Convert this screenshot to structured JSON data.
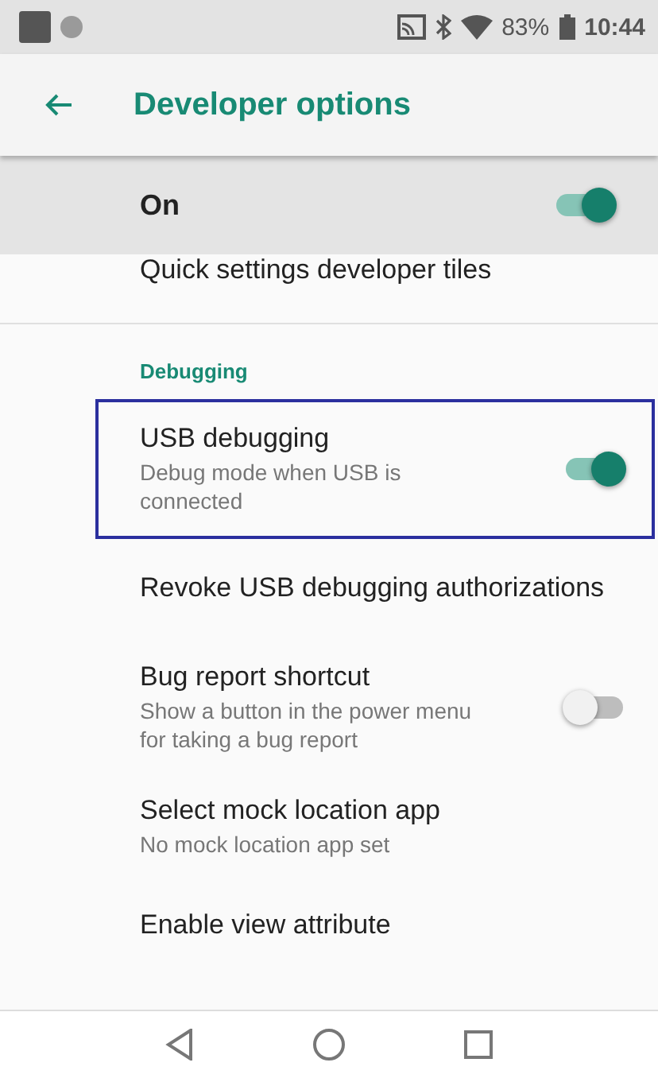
{
  "status_bar": {
    "battery": "83%",
    "time": "10:44"
  },
  "app_bar": {
    "title": "Developer options"
  },
  "master_switch": {
    "label": "On",
    "on": true
  },
  "items": [
    {
      "kind": "plain",
      "title": "Quick settings developer tiles"
    },
    {
      "kind": "header",
      "title": "Debugging"
    },
    {
      "kind": "switch",
      "title": "USB debugging",
      "summary": "Debug mode when USB is connected",
      "on": true,
      "highlighted": true
    },
    {
      "kind": "plain",
      "title": "Revoke USB debugging authorizations"
    },
    {
      "kind": "switch",
      "title": "Bug report shortcut",
      "summary": "Show a button in the power menu for taking a bug report",
      "on": false,
      "highlighted": false
    },
    {
      "kind": "plain",
      "title": "Select mock location app",
      "summary": "No mock location app set"
    },
    {
      "kind": "plain",
      "title": "Enable view attribute"
    }
  ]
}
